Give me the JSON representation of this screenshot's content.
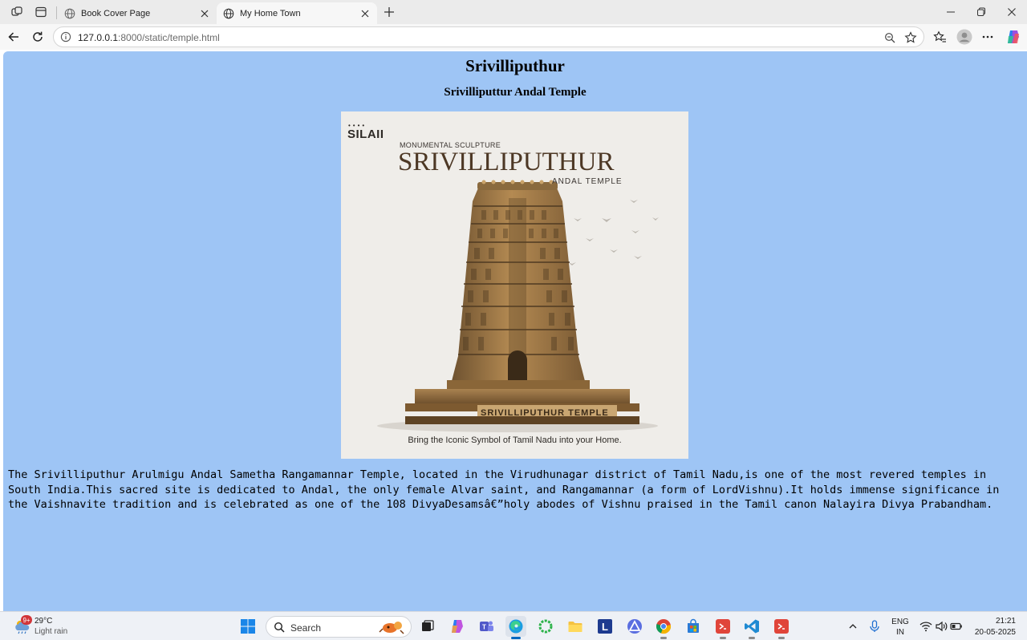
{
  "browser": {
    "tabs": [
      {
        "title": "Book Cover Page",
        "active": false
      },
      {
        "title": "My Home Town",
        "active": true
      }
    ],
    "url_host": "127.0.0.1",
    "url_path": ":8000/static/temple.html"
  },
  "page": {
    "heading": "Srivilliputhur",
    "subheading": "Srivilliputtur Andal Temple",
    "image": {
      "brand": "SILAII",
      "kicker": "MONUMENTAL SCULPTURE",
      "title": "SRIVILLIPUTHUR",
      "subtitle": "ANDAL TEMPLE",
      "base_label": "SRIVILLIPUTHUR TEMPLE",
      "tagline": "Bring the Iconic Symbol of Tamil Nadu into your Home."
    },
    "paragraph": "The Srivilliputhur Arulmigu Andal Sametha Rangamannar Temple, located in the Virudhunagar district of Tamil Nadu,is one of the most revered temples in South India.This sacred site is dedicated to Andal, the only female Alvar saint, and Rangamannar (a form of LordVishnu).It holds immense significance in the Vaishnavite tradition and is celebrated as one of the 108 DivyaDesamsâ€”holy abodes of Vishnu praised in the Tamil canon Nalayira Divya Prabandham.",
    "background": "#9ec5f5"
  },
  "taskbar": {
    "weather_badge": "9+",
    "weather_temp": "29°C",
    "weather_condition": "Light rain",
    "search_label": "Search",
    "lang_line1": "ENG",
    "lang_line2": "IN",
    "time": "21:21",
    "date": "20-05-2025"
  }
}
